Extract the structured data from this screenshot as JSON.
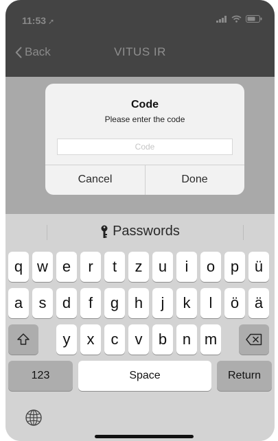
{
  "status": {
    "time": "11:53",
    "location_icon": "location-arrow-icon",
    "signal_icon": "cellular-signal-icon",
    "wifi_icon": "wifi-icon",
    "battery_icon": "battery-icon"
  },
  "nav": {
    "back_label": "Back",
    "title": "VITUS IR"
  },
  "dialog": {
    "title": "Code",
    "message": "Please enter the code",
    "input_placeholder": "Code",
    "input_value": "",
    "cancel_label": "Cancel",
    "done_label": "Done"
  },
  "keyboard": {
    "suggestion": "Passwords",
    "row1": [
      "q",
      "w",
      "e",
      "r",
      "t",
      "z",
      "u",
      "i",
      "o",
      "p",
      "ü"
    ],
    "row2": [
      "a",
      "s",
      "d",
      "f",
      "g",
      "h",
      "j",
      "k",
      "l",
      "ö",
      "ä"
    ],
    "row3": [
      "y",
      "x",
      "c",
      "v",
      "b",
      "n",
      "m"
    ],
    "numbers_label": "123",
    "space_label": "Space",
    "return_label": "Return"
  },
  "colors": {
    "topbar": "#444444",
    "dim_overlay": "#a9a9a9",
    "dialog_bg": "#f2f2f2",
    "keyboard_bg": "#d3d3d3"
  }
}
